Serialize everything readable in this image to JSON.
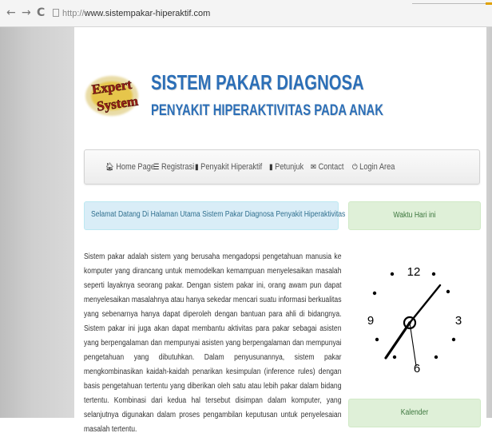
{
  "browser": {
    "back_icon": "arrow-left-icon",
    "forward_icon": "arrow-right-icon",
    "reload_icon": "reload-icon",
    "url_protocol": "http://",
    "url_domain": "www.sistempakar-hiperaktif.com"
  },
  "header": {
    "logo_line1": "Expert",
    "logo_line2": "System",
    "title": "SISTEM PAKAR DIAGNOSA",
    "subtitle": "PENYAKIT HIPERAKTIVITAS PADA ANAK"
  },
  "nav": {
    "items": [
      {
        "label": "Home Page",
        "icon": "home-icon"
      },
      {
        "label": "Registrasi",
        "icon": "list-icon"
      },
      {
        "label": "Penyakit Hiperaktif",
        "icon": "book-icon"
      },
      {
        "label": "Petunjuk",
        "icon": "book-icon"
      },
      {
        "label": "Contact",
        "icon": "envelope-icon"
      },
      {
        "label": "Login Area",
        "icon": "power-icon"
      }
    ]
  },
  "welcome": "Selamat Datang Di Halaman Utama Sistem Pakar Diagnosa Penyakit Hiperaktivitas",
  "sidebar": {
    "time_title": "Waktu Hari ini",
    "calendar_title": "Kalender",
    "clock": {
      "n12": "12",
      "n3": "3",
      "n6": "6",
      "n9": "9"
    }
  },
  "main_text": "Sistem pakar adalah sistem yang berusaha mengadopsi pengetahuan manusia ke komputer yang dirancang untuk memodelkan kemampuan menyelesaikan masalah seperti layaknya seorang pakar. Dengan sistem pakar ini, orang awam pun dapat menyelesaikan masalahnya atau hanya sekedar mencari suatu informasi berkualitas yang sebenarnya hanya dapat diperoleh dengan bantuan para ahli di bidangnya. Sistem pakar ini juga akan dapat membantu aktivitas para pakar sebagai asisten yang berpengalaman dan mempunyai asisten yang berpengalaman dan mempunyai pengetahuan yang dibutuhkan. Dalam penyusunannya, sistem pakar mengkombinasikan kaidah-kaidah penarikan kesimpulan (inference rules) dengan basis pengetahuan tertentu yang diberikan oleh satu atau lebih pakar dalam bidang tertentu. Kombinasi dari kedua hal tersebut disimpan dalam komputer, yang selanjutnya digunakan dalam proses pengambilan keputusan untuk penyelesaian masalah tertentu.",
  "colors": {
    "title_blue": "#2c6fb7",
    "alert_info_bg": "#d9edf7",
    "alert_info_text": "#31708f",
    "panel_green_bg": "#dff0d8",
    "panel_green_text": "#3c763d"
  }
}
